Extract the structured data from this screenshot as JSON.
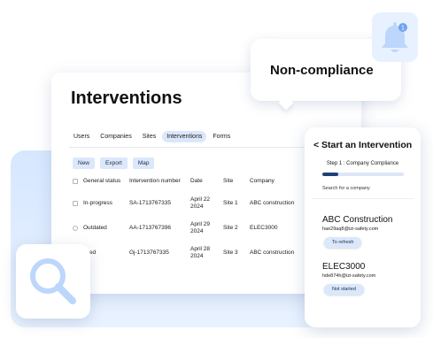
{
  "notification": {
    "label": "Non-compliance",
    "badge_count": "1",
    "icon": "bell-icon"
  },
  "main": {
    "title": "Interventions",
    "tabs": [
      {
        "label": "Users"
      },
      {
        "label": "Companies"
      },
      {
        "label": "Sites"
      },
      {
        "label": "Interventions",
        "active": true
      },
      {
        "label": "Forms"
      }
    ],
    "toolbar": {
      "new_label": "New",
      "export_label": "Export",
      "map_label": "Map"
    },
    "table": {
      "headers": {
        "status": "General status",
        "number": "Intervention number",
        "date": "Date",
        "site": "Site",
        "company": "Company"
      },
      "rows": [
        {
          "status": "In-progress",
          "number": "SA-1713767335",
          "date_line1": "April 22",
          "date_line2": "2024",
          "site": "Site 1",
          "company": "ABC construction"
        },
        {
          "status": "Outdated",
          "number": "AA-1713767396",
          "date_line1": "April 29",
          "date_line2": "2024",
          "site": "Site 2",
          "company": "ELEC3000"
        },
        {
          "status": "Closed",
          "status_visible": "osed",
          "number": "Gj-1713767335",
          "date_line1": "April 28",
          "date_line2": "2024",
          "site": "Site 3",
          "company": "ABC construction"
        }
      ]
    }
  },
  "phone": {
    "title": "< Start an Intervention",
    "step": "Step 1 : Company Compliance",
    "progress_fraction": 0.2,
    "search_label": "Search for a company",
    "companies": [
      {
        "name": "ABC Construction",
        "email": "hae29aq8@izi-safety.com",
        "status": "To refresh"
      },
      {
        "name": "ELEC3000",
        "email": "hde874h@izi-safety.com",
        "status": "Not started"
      }
    ]
  },
  "search_tile": {
    "icon": "magnifier-icon"
  },
  "colors": {
    "accent_light": "#dbe8fb",
    "accent_dark": "#1d3f7a",
    "icon_blue": "#bcd7fb",
    "background_blue": "#d6e7ff"
  }
}
